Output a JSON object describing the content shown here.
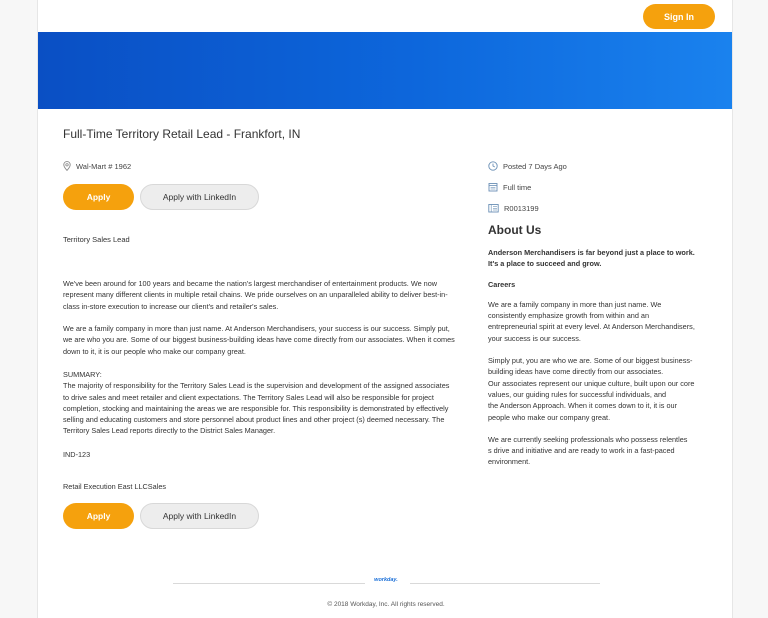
{
  "header": {
    "sign_in": "Sign In"
  },
  "job": {
    "title": "Full-Time Territory Retail Lead - Frankfort, IN",
    "location": "Wal-Mart # 1962",
    "apply_label": "Apply",
    "apply_linkedin_label": "Apply with LinkedIn",
    "subtitle": "Territory Sales Lead",
    "description": {
      "para1": [
        "We've been around for 100 years and became the nation's largest merchandiser of entertainment products. We now",
        "represent many different clients in multiple retail chains. We pride ourselves on an unparalleled ability to deliver best-in-",
        "class in-store execution to increase our client's and retailer's sales."
      ],
      "para2": [
        "We are a family company in more than just name. At Anderson Merchandisers, your success is our success. Simply put,",
        "we are who you are. Some of our biggest business-building ideas have come directly from our associates. When it comes",
        "down to it, it is our people who make our company great."
      ],
      "summary": [
        "SUMMARY:",
        "The majority of responsibility for the Territory Sales Lead is the supervision and development of the assigned associates",
        "to drive sales and meet retailer and client expectations. The Territory Sales Lead will also be responsible for project",
        "completion, stocking and maintaining the areas we are responsible for.  This responsibility is demonstrated by effectively",
        "selling and educating customers and store personnel about product lines and other project (s) deemed necessary.  The",
        "Territory Sales Lead reports directly to the District Sales Manager."
      ],
      "code": "IND-123",
      "org": "Retail Execution East LLCSales"
    }
  },
  "sidebar": {
    "posted": "Posted 7 Days Ago",
    "time_type": "Full time",
    "req_id": "R0013199",
    "about_heading": "About Us",
    "about_intro": [
      "Anderson Merchandisers is far beyond just a place to work.",
      "It's a place to succeed and grow."
    ],
    "careers_heading": "Careers",
    "p1": [
      "We are a family company in more than just name. We",
      "consistently emphasize growth from within and an",
      "entrepreneurial spirit at every level. At Anderson Merchandisers,",
      "your success is our success."
    ],
    "p2": [
      "Simply put, you are who we are. Some of our biggest business-",
      "building ideas have come directly from our associates.",
      "Our associates represent our unique culture, built upon our core",
      "values, our guiding rules for successful individuals, and",
      "the Anderson Approach. When it comes down to it, it is our",
      "people who make our company great."
    ],
    "p3": [
      "We are currently seeking professionals who possess relentles",
      "s drive and initiative and are ready to work in a fast-paced",
      "environment."
    ]
  },
  "footer": {
    "logo_text": "workday.",
    "copyright": "© 2018 Workday, Inc. All rights reserved."
  },
  "colors": {
    "accent": "#f5a10d",
    "banner": "#0d67dc",
    "brand_blue": "#1a6fd8"
  },
  "icons": [
    "location-pin-icon",
    "clock-icon",
    "calendar-icon",
    "id-card-icon"
  ]
}
